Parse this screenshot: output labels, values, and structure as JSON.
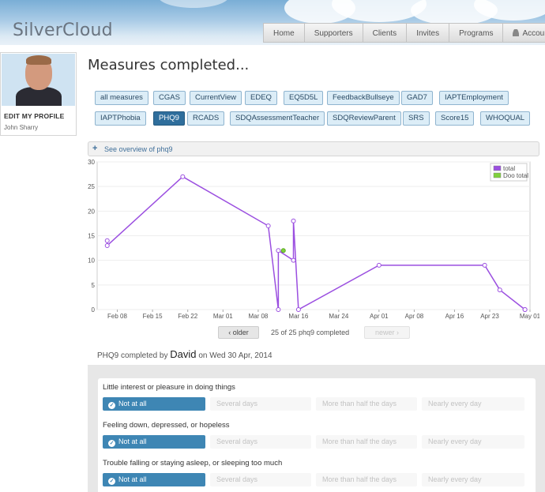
{
  "header": {
    "logo": "SilverCloud",
    "nav": [
      {
        "label": "Home",
        "name": "nav-home"
      },
      {
        "label": "Supporters",
        "name": "nav-supporters"
      },
      {
        "label": "Clients",
        "name": "nav-clients"
      },
      {
        "label": "Invites",
        "name": "nav-invites"
      },
      {
        "label": "Programs",
        "name": "nav-programs"
      },
      {
        "label": "Account",
        "name": "nav-account"
      }
    ]
  },
  "sidebar": {
    "edit_profile": "EDIT MY PROFILE",
    "user_name": "John Sharry"
  },
  "page": {
    "title": "Measures completed...",
    "tags": [
      "all measures",
      "CGAS",
      "CurrentView",
      "EDEQ",
      "EQ5D5L",
      "FeedbackBullseye",
      "GAD7",
      "IAPTEmployment",
      "IAPTPhobia",
      "PHQ9",
      "RCADS",
      "SDQAssessmentTeacher",
      "SDQReviewParent",
      "SRS",
      "Score15",
      "WHOQUAL"
    ],
    "active_tag": "PHQ9",
    "overview_label": "See overview of phq9"
  },
  "pager": {
    "older": "older",
    "status": "25 of 25 phq9 completed",
    "newer": "newer"
  },
  "completion": {
    "prefix": "PHQ9 completed by",
    "who": "David",
    "suffix": "on Wed 30 Apr, 2014"
  },
  "questions": [
    {
      "text": "Little interest or pleasure in doing things",
      "selected": 0
    },
    {
      "text": "Feeling down, depressed, or hopeless",
      "selected": 0
    },
    {
      "text": "Trouble falling or staying asleep, or sleeping too much",
      "selected": 0
    }
  ],
  "answer_options": [
    "Not at all",
    "Several days",
    "More than half the days",
    "Nearly every day"
  ],
  "colors": {
    "accent": "#3e86b4",
    "tag_active": "#2f6e9c",
    "series_total": "#9b4fe0",
    "series_doo_total": "#7fd13b"
  },
  "chart_data": {
    "type": "line",
    "ylim": [
      0,
      30
    ],
    "yticks": [
      0,
      5,
      10,
      15,
      20,
      25,
      30
    ],
    "xticks": [
      "Feb 08",
      "Feb 15",
      "Feb 22",
      "Mar 01",
      "Mar 08",
      "Mar 16",
      "Mar 24",
      "Apr 01",
      "Apr 08",
      "Apr 16",
      "Apr 23",
      "May 01"
    ],
    "legend_position": "top-right",
    "series": [
      {
        "name": "total",
        "color": "#9b4fe0",
        "points": [
          [
            "Feb 06",
            14
          ],
          [
            "Feb 06",
            13
          ],
          [
            "Feb 21",
            27
          ],
          [
            "Mar 10",
            17
          ],
          [
            "Mar 12",
            0
          ],
          [
            "Mar 12",
            12
          ],
          [
            "Mar 15",
            10
          ],
          [
            "Mar 15",
            18
          ],
          [
            "Mar 16",
            0
          ],
          [
            "Apr 01",
            9
          ],
          [
            "Apr 22",
            9
          ],
          [
            "Apr 25",
            4
          ],
          [
            "Apr 30",
            0
          ],
          [
            "Apr 30",
            0
          ]
        ]
      },
      {
        "name": "Doo total",
        "color": "#7fd13b",
        "points": [
          [
            "Mar 13",
            12
          ]
        ]
      }
    ]
  }
}
